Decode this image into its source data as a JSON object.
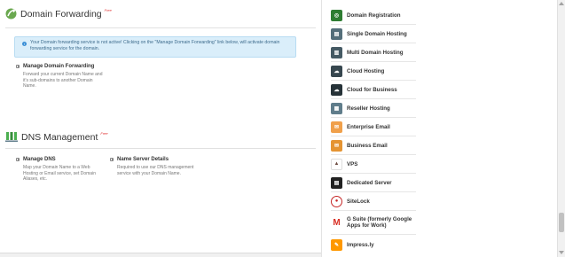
{
  "domain_forwarding": {
    "title": "Domain Forwarding",
    "free_tag": "Free",
    "alert": "Your Domain forwarding service is not active! Clicking on the \"Manage Domain Forwarding\" link below, will activate domain forwarding service for the domain.",
    "items": [
      {
        "label": "Manage Domain Forwarding",
        "desc": "Forward your current Domain Name and it's sub-domains to another Domain Name."
      }
    ]
  },
  "dns_management": {
    "title": "DNS Management",
    "free_tag": "Free",
    "items": [
      {
        "label": "Manage DNS",
        "desc": "Map your Domain Name to a Web Hosting or Email service, set Domain Aliases, etc."
      },
      {
        "label": "Name Server Details",
        "desc": "Required to use our DNS management service with your Domain Name."
      }
    ]
  },
  "sidebar": {
    "items": [
      {
        "label": "Domain Registration",
        "icon": "globe-icon",
        "color": "#2e7d32"
      },
      {
        "label": "Single Domain Hosting",
        "icon": "server-icon",
        "color": "#546e7a"
      },
      {
        "label": "Multi Domain Hosting",
        "icon": "multi-server-icon",
        "color": "#455a64"
      },
      {
        "label": "Cloud Hosting",
        "icon": "cloud-monitor-icon",
        "color": "#37474f"
      },
      {
        "label": "Cloud for Business",
        "icon": "cloud-monitor-icon",
        "color": "#263238"
      },
      {
        "label": "Reseller Hosting",
        "icon": "reseller-server-icon",
        "color": "#607d8b"
      },
      {
        "label": "Enterprise Email",
        "icon": "envelope-icon",
        "color": "#f0a04b"
      },
      {
        "label": "Business Email",
        "icon": "envelope-icon",
        "color": "#e59432"
      },
      {
        "label": "VPS",
        "icon": "vps-icon",
        "color": "#6d4c41"
      },
      {
        "label": "Dedicated Server",
        "icon": "dedicated-server-icon",
        "color": "#212121"
      },
      {
        "label": "SiteLock",
        "icon": "sitelock-icon",
        "color": "#c62828"
      },
      {
        "label": "G Suite (formerly Google Apps for Work)",
        "icon": "gmail-icon",
        "color": "#d93025"
      },
      {
        "label": "Impress.ly",
        "icon": "impressly-icon",
        "color": "#ff9800"
      }
    ]
  }
}
